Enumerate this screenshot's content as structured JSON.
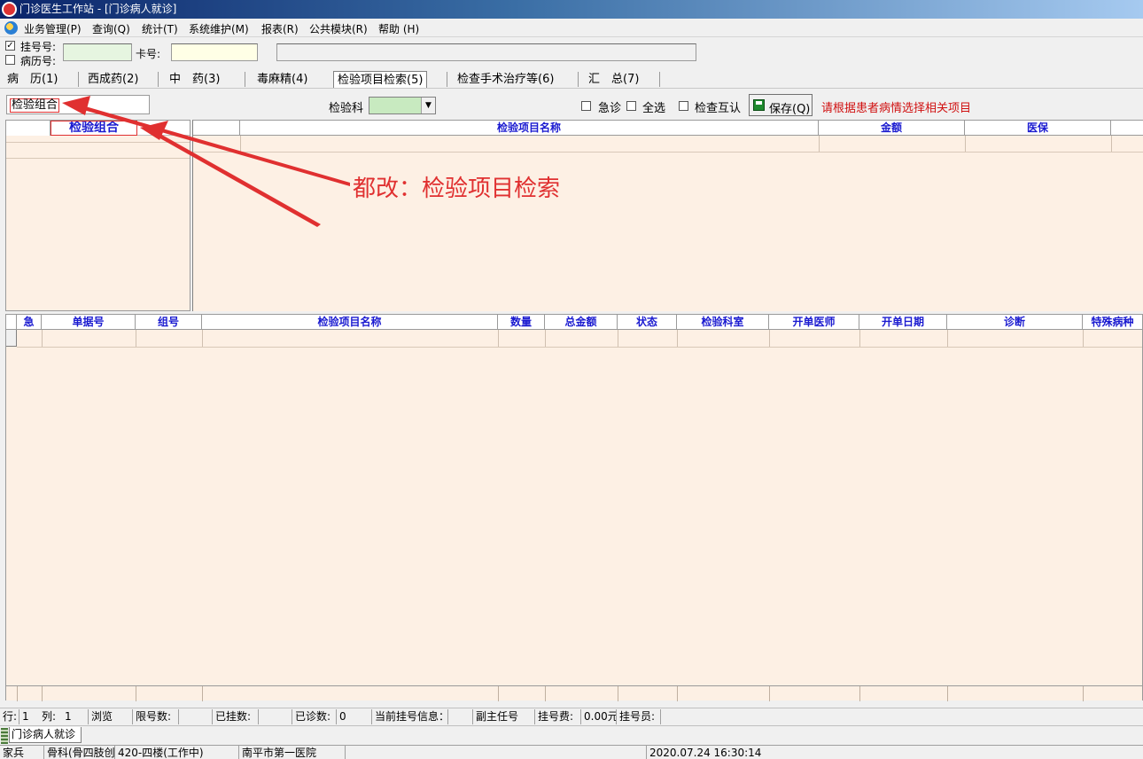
{
  "window": {
    "title": "门诊医生工作站 - [门诊病人就诊]"
  },
  "menu": [
    "业务管理(P)",
    "查询(Q)",
    "统计(T)",
    "系统维护(M)",
    "报表(R)",
    "公共模块(R)",
    "帮助 (H)"
  ],
  "patient": {
    "reg_no_label": "挂号号:",
    "reg_no_checked": "✓",
    "record_no_label": "病历号:",
    "card_label": "卡号:"
  },
  "tabs": [
    "病　历(1)",
    "西成药(2)",
    "中　药(3)",
    "毒麻精(4)",
    "检验项目检索(5)",
    "检查手术治疗等(6)",
    "汇　总(7)"
  ],
  "filter": {
    "combo_label": "检验组合",
    "dept_label": "检验科",
    "urgent_label": "急诊",
    "select_all_label": "全选",
    "mutual_label": "检查互认",
    "save_label": "保存(Q)",
    "hint": "请根据患者病情选择相关项目"
  },
  "left_table": {
    "header": "检验组合"
  },
  "right_table": {
    "headers": [
      "检验项目名称",
      "金额",
      "医保"
    ]
  },
  "bottom_table": {
    "headers": [
      "急",
      "单据号",
      "组号",
      "检验项目名称",
      "数量",
      "总金额",
      "状态",
      "检验科室",
      "开单医师",
      "开单日期",
      "诊断",
      "特殊病种"
    ]
  },
  "annotation": "都改：检验项目检索",
  "status": {
    "row_label": "行:",
    "row_value": "1",
    "col_label": "列:",
    "col_value": "1",
    "mode": "浏览",
    "limit_label": "限号数:",
    "registered_label": "已挂数:",
    "diagnosed_label": "已诊数:",
    "diagnosed_value": "0",
    "current_reg_label": "当前挂号信息：",
    "title_value": "副主任号",
    "fee_label": "挂号费:",
    "fee_value": "0.00元",
    "registrar_label": "挂号员:"
  },
  "task_tab": "门诊病人就诊",
  "footer": {
    "user": "家兵",
    "dept": "骨科(骨四肢创",
    "room": "420-四楼(工作中)",
    "hospital": "南平市第一医院",
    "datetime": "2020.07.24 16:30:14"
  },
  "colors": {
    "panel_bg": "#fdf0e4",
    "header_text": "#1a1ad0",
    "annotation": "#e03030",
    "hint": "#d01010"
  }
}
